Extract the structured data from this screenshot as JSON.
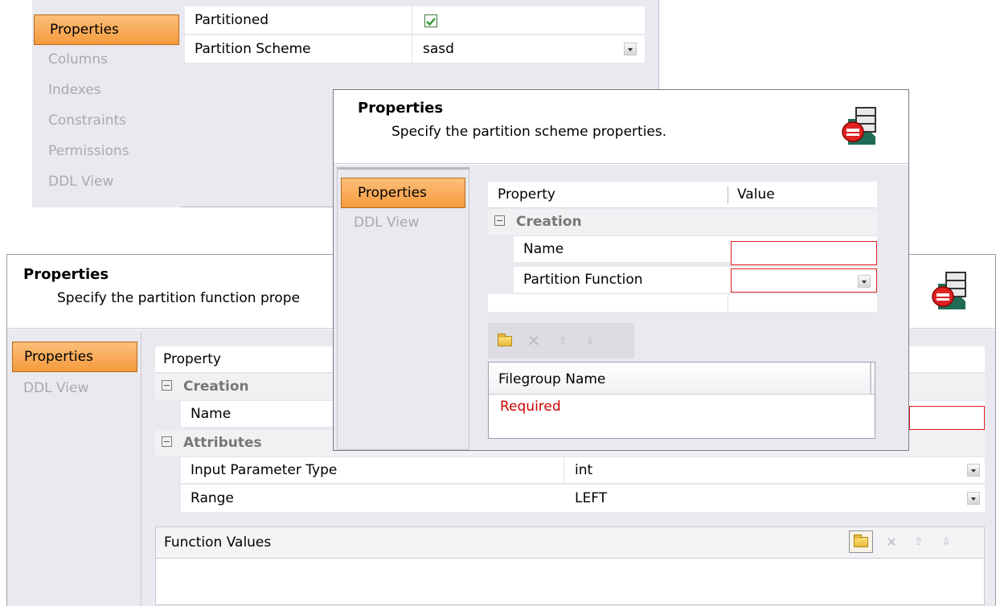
{
  "back_window": {
    "nav": [
      {
        "label": "Properties",
        "active": true
      },
      {
        "label": "Columns",
        "active": false
      },
      {
        "label": "Indexes",
        "active": false
      },
      {
        "label": "Constraints",
        "active": false
      },
      {
        "label": "Permissions",
        "active": false
      },
      {
        "label": "DDL View",
        "active": false
      }
    ],
    "rows": [
      {
        "label": "Partitioned",
        "value": "",
        "checked": true
      },
      {
        "label": "Partition Scheme",
        "value": "sasd"
      }
    ]
  },
  "function_window": {
    "title": "Properties",
    "subtitle": "Specify the partition function prope",
    "nav": [
      {
        "label": "Properties",
        "active": true
      },
      {
        "label": "DDL View",
        "active": false
      }
    ],
    "grid_header": "Property",
    "groups": {
      "creation": "Creation",
      "attributes": "Attributes"
    },
    "rows": {
      "name": "Name",
      "input_type_label": "Input Parameter Type",
      "input_type_value": "int",
      "range_label": "Range",
      "range_value": "LEFT"
    },
    "function_values_label": "Function Values"
  },
  "scheme_window": {
    "title": "Properties",
    "subtitle": "Specify the partition scheme properties.",
    "nav": [
      {
        "label": "Properties",
        "active": true
      },
      {
        "label": "DDL View",
        "active": false
      }
    ],
    "grid_header_property": "Property",
    "grid_header_value": "Value",
    "group_creation": "Creation",
    "rows": {
      "name": "Name",
      "partition_function": "Partition Function"
    },
    "filegroup_header": "Filegroup Name",
    "filegroup_required": "Required"
  },
  "colors": {
    "accent_orange": "#f59b3e",
    "required_red": "#cc0000",
    "nav_bg": "#e9e9ef"
  }
}
